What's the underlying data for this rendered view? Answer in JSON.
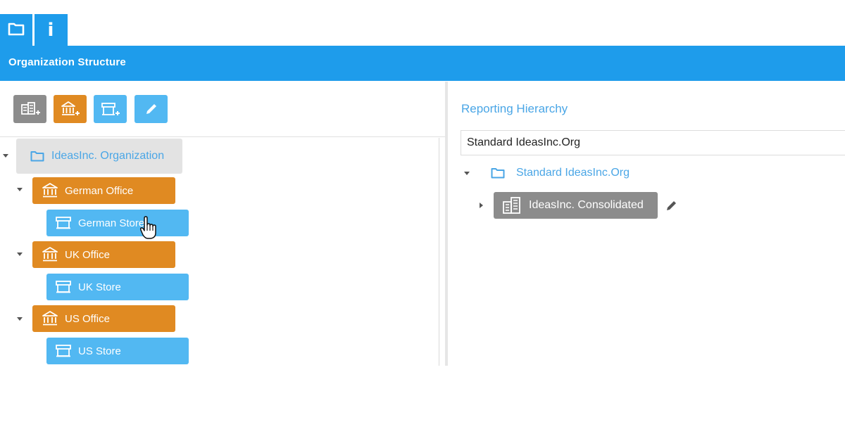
{
  "tabs": [
    {
      "name": "folder-icon"
    },
    {
      "name": "info-icon",
      "glyph": "i"
    }
  ],
  "header": {
    "title": "Organization Structure"
  },
  "toolbar": {
    "buttons": [
      {
        "name": "add-entity-button",
        "icon": "add-building-icon",
        "color": "#8c8c8c"
      },
      {
        "name": "add-office-button",
        "icon": "add-bank-icon",
        "color": "#e08a22"
      },
      {
        "name": "add-store-button",
        "icon": "add-store-icon",
        "color": "#52b8f2"
      },
      {
        "name": "edit-button",
        "icon": "pencil-icon",
        "color": "#52b8f2"
      }
    ]
  },
  "tree": {
    "root": {
      "label": "IdeasInc. Organization",
      "icon": "folder-icon"
    },
    "offices": [
      {
        "label": "German Office",
        "icon": "bank-icon",
        "store": {
          "label": "German Store",
          "icon": "store-icon"
        }
      },
      {
        "label": "UK Office",
        "icon": "bank-icon",
        "store": {
          "label": "UK Store",
          "icon": "store-icon"
        }
      },
      {
        "label": "US Office",
        "icon": "bank-icon",
        "store": {
          "label": "US Store",
          "icon": "store-icon"
        }
      }
    ]
  },
  "reporting": {
    "title": "Reporting Hierarchy",
    "input_value": "Standard IdeasInc.Org",
    "root": {
      "label": "Standard IdeasInc.Org",
      "icon": "folder-icon"
    },
    "child": {
      "label": "IdeasInc. Consolidated",
      "icon": "building-icon"
    }
  },
  "colors": {
    "accent": "#1e9ceb",
    "office": "#e08a22",
    "store": "#52b8f2",
    "entity": "#8c8c8c"
  }
}
